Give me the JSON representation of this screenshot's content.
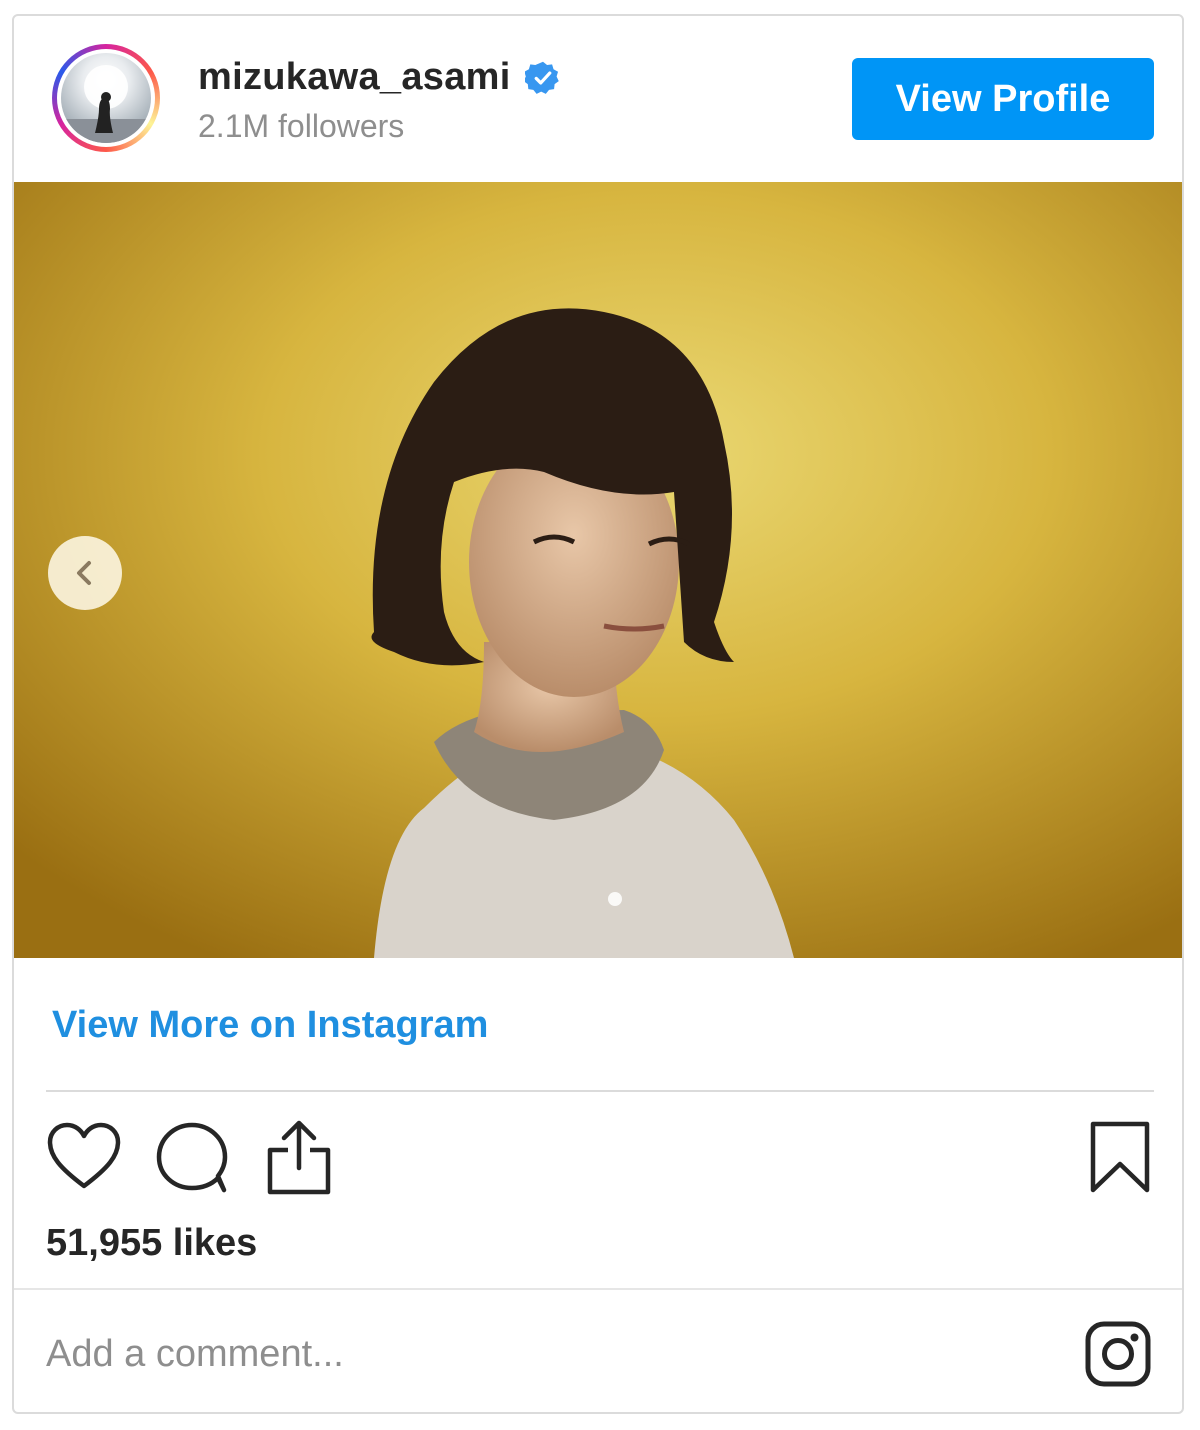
{
  "header": {
    "username": "mizukawa_asami",
    "followers": "2.1M followers",
    "view_profile_label": "View Profile",
    "verified_color": "#3897f0"
  },
  "photo": {
    "background_color": "#d8b23a",
    "carousel_prev_icon": "chevron-left-icon"
  },
  "links": {
    "view_more": "View More on Instagram",
    "link_color": "#1f8fe0"
  },
  "actions": {
    "icons": [
      "heart-icon",
      "comment-icon",
      "share-icon",
      "bookmark-icon"
    ],
    "likes": "51,955 likes"
  },
  "comment": {
    "placeholder": "Add a comment...",
    "logo_icon": "instagram-icon"
  },
  "colors": {
    "button_blue": "#0095f6",
    "text_dark": "#262626",
    "text_muted": "#8e8e8e"
  }
}
